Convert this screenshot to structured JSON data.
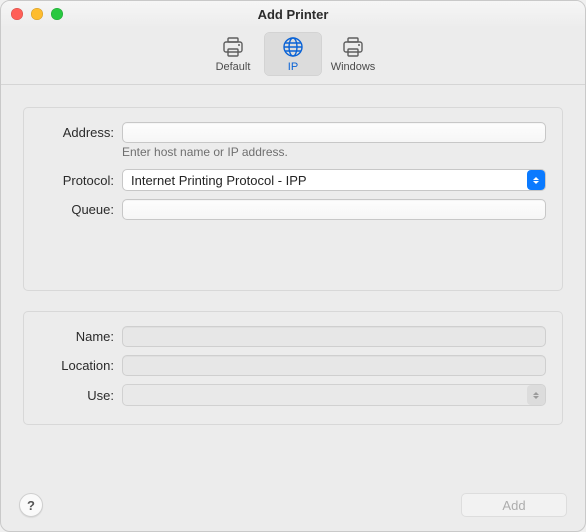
{
  "window": {
    "title": "Add Printer"
  },
  "toolbar": {
    "items": [
      {
        "id": "default",
        "label": "Default",
        "icon": "printer-icon"
      },
      {
        "id": "ip",
        "label": "IP",
        "icon": "globe-icon"
      },
      {
        "id": "windows",
        "label": "Windows",
        "icon": "printer-icon"
      }
    ],
    "selected": "ip"
  },
  "fields": {
    "address": {
      "label": "Address:",
      "value": "",
      "hint": "Enter host name or IP address."
    },
    "protocol": {
      "label": "Protocol:",
      "value": "Internet Printing Protocol - IPP"
    },
    "queue": {
      "label": "Queue:",
      "value": ""
    },
    "name": {
      "label": "Name:",
      "value": ""
    },
    "location": {
      "label": "Location:",
      "value": ""
    },
    "use": {
      "label": "Use:",
      "value": ""
    }
  },
  "footer": {
    "help_label": "?",
    "add_label": "Add",
    "add_enabled": false
  }
}
